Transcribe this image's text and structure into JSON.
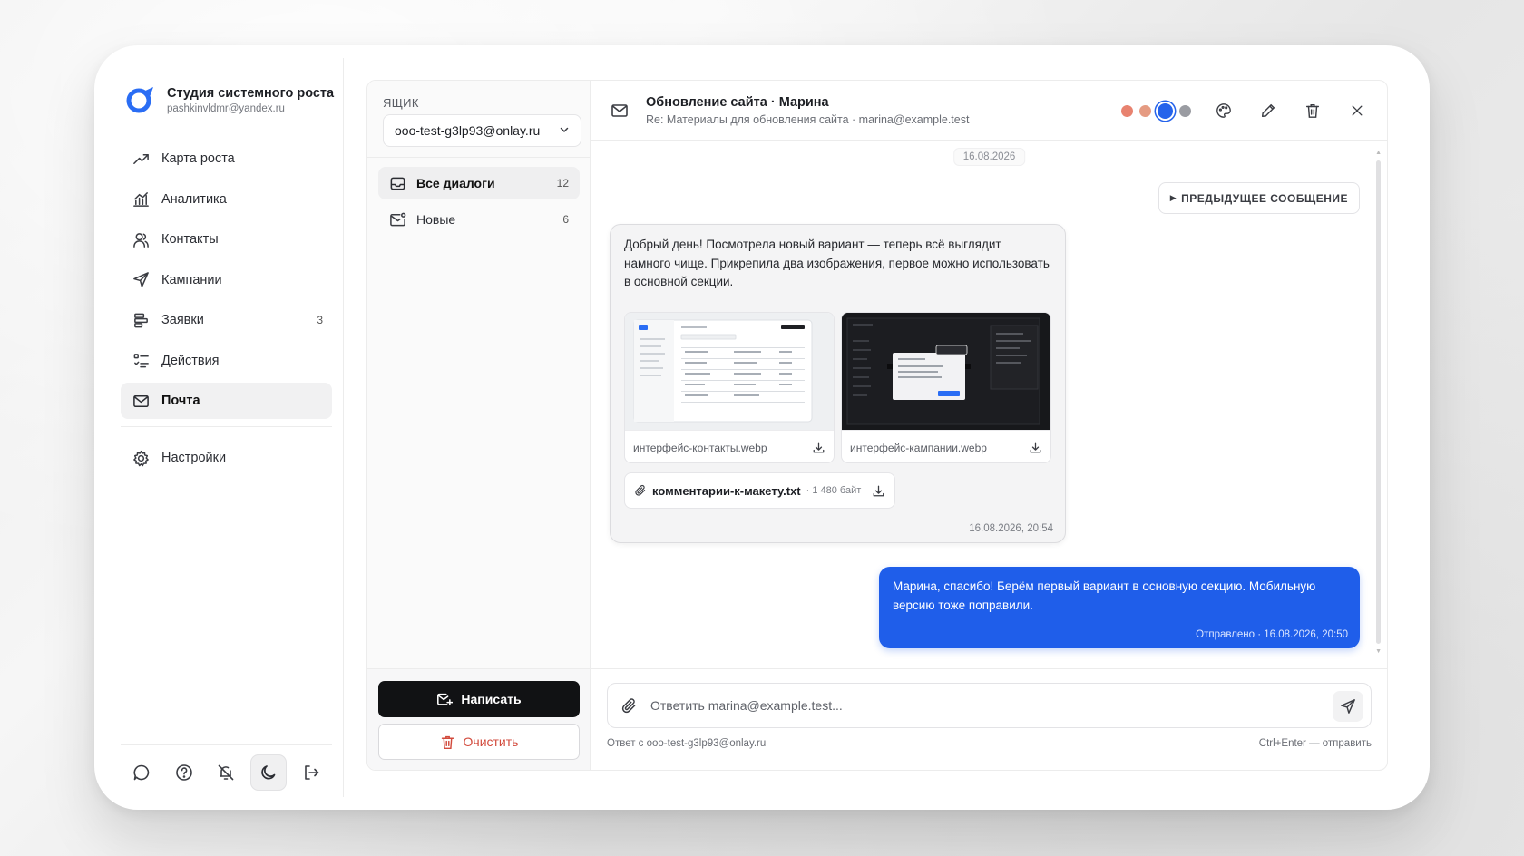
{
  "brand": {
    "title": "Студия системного роста",
    "email": "pashkinvldmr@yandex.ru"
  },
  "nav": {
    "items": [
      {
        "label": "Карта роста",
        "icon": "trend-up-icon",
        "badge": ""
      },
      {
        "label": "Аналитика",
        "icon": "analytics-icon",
        "badge": ""
      },
      {
        "label": "Контакты",
        "icon": "contacts-icon",
        "badge": ""
      },
      {
        "label": "Кампании",
        "icon": "send-icon",
        "badge": ""
      },
      {
        "label": "Заявки",
        "icon": "requests-icon",
        "badge": "3"
      },
      {
        "label": "Действия",
        "icon": "tasks-icon",
        "badge": ""
      },
      {
        "label": "Почта",
        "icon": "mail-icon",
        "badge": "",
        "active": true
      }
    ],
    "settings": {
      "label": "Настройки",
      "icon": "gear-icon"
    }
  },
  "bottom_bar": [
    "chat-icon",
    "help-icon",
    "bell-off-icon",
    "moon-icon",
    "logout-icon"
  ],
  "mailbox": {
    "label": "ЯЩИК",
    "selected": "ooo-test-g3lp93@onlay.ru",
    "folders": [
      {
        "label": "Все диалоги",
        "count": "12",
        "active": true
      },
      {
        "label": "Новые",
        "count": "6"
      }
    ],
    "compose_label": "Написать",
    "clear_label": "Очистить"
  },
  "conversation": {
    "subject": "Обновление сайта · Марина",
    "subtitle": "Re: Материалы для обновления сайта · marina@example.test",
    "colors": [
      "#e8826f",
      "#e59b82",
      "#2563eb",
      "#9a9ca2"
    ],
    "date_chip": "16.08.2026",
    "prev_label": "ПРЕДЫДУЩЕЕ СООБЩЕНИЕ",
    "incoming": {
      "text": "Добрый день! Посмотрела новый вариант — теперь всё выглядит намного чище. Прикрепила два изображения, первое можно использовать в основной секции.",
      "attachments": [
        {
          "name": "интерфейс-контакты.webp"
        },
        {
          "name": "интерфейс-кампании.webp"
        }
      ],
      "file": {
        "name": "комментарии-к-макету.txt",
        "size": "· 1 480 байт"
      },
      "time": "16.08.2026, 20:54"
    },
    "outgoing": {
      "text": "Марина, спасибо! Берём первый вариант в основную секцию. Мобильную версию тоже поправили.",
      "time": "Отправлено · 16.08.2026, 20:50"
    },
    "composer": {
      "placeholder": "Ответить marina@example.test...",
      "from_note": "Ответ с ooo-test-g3lp93@onlay.ru",
      "hint": "Ctrl+Enter — отправить"
    }
  }
}
